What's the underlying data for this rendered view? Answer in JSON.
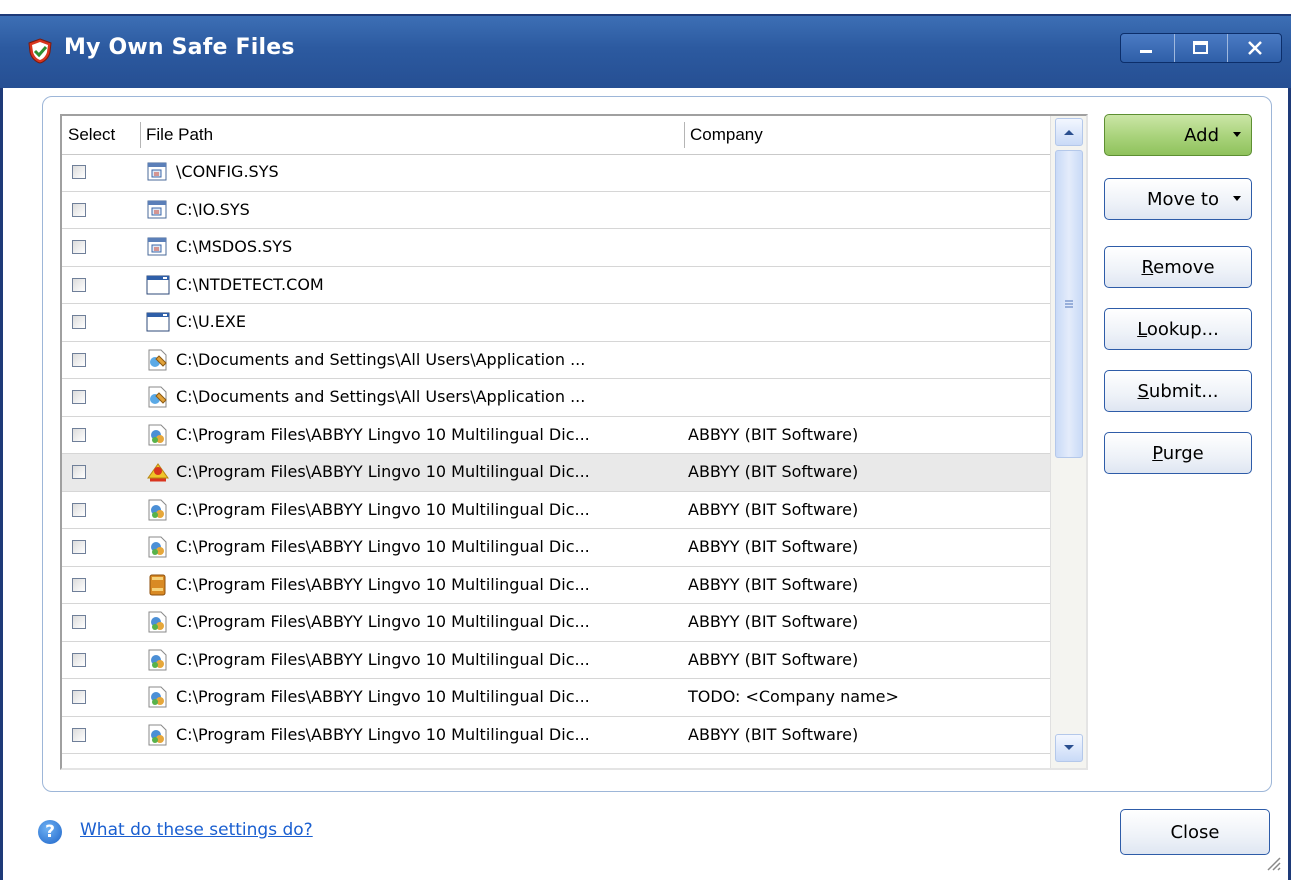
{
  "window": {
    "title": "My Own Safe Files",
    "controls": [
      "minimize-icon",
      "maximize-icon",
      "close-icon"
    ]
  },
  "colors": {
    "titlebar": "#2c5aa0",
    "add_button": "#a8d27a",
    "link": "#1a5fd0",
    "selected_row": "#e9e9e9"
  },
  "list": {
    "columns": {
      "select": "Select",
      "file_path": "File Path",
      "company": "Company"
    },
    "rows": [
      {
        "icon": "system-file-icon",
        "path": "\\CONFIG.SYS",
        "company": "",
        "checked": false
      },
      {
        "icon": "system-file-icon",
        "path": "C:\\IO.SYS",
        "company": "",
        "checked": false
      },
      {
        "icon": "system-file-icon",
        "path": "C:\\MSDOS.SYS",
        "company": "",
        "checked": false
      },
      {
        "icon": "app-window-icon",
        "path": "C:\\NTDETECT.COM",
        "company": "",
        "checked": false
      },
      {
        "icon": "app-window-icon",
        "path": "C:\\U.EXE",
        "company": "",
        "checked": false
      },
      {
        "icon": "settings-file-icon",
        "path": "C:\\Documents and Settings\\All Users\\Application ...",
        "company": "",
        "checked": false
      },
      {
        "icon": "settings-file-icon",
        "path": "C:\\Documents and Settings\\All Users\\Application ...",
        "company": "",
        "checked": false
      },
      {
        "icon": "dll-file-icon",
        "path": "C:\\Program Files\\ABBYY Lingvo 10 Multilingual Dic...",
        "company": "ABBYY (BIT Software)",
        "checked": false
      },
      {
        "icon": "lingvo-app-icon",
        "path": "C:\\Program Files\\ABBYY Lingvo 10 Multilingual Dic...",
        "company": "ABBYY (BIT Software)",
        "checked": false,
        "selected": true
      },
      {
        "icon": "dll-file-icon",
        "path": "C:\\Program Files\\ABBYY Lingvo 10 Multilingual Dic...",
        "company": "ABBYY (BIT Software)",
        "checked": false
      },
      {
        "icon": "dll-file-icon",
        "path": "C:\\Program Files\\ABBYY Lingvo 10 Multilingual Dic...",
        "company": "ABBYY (BIT Software)",
        "checked": false
      },
      {
        "icon": "book-icon",
        "path": "C:\\Program Files\\ABBYY Lingvo 10 Multilingual Dic...",
        "company": "ABBYY (BIT Software)",
        "checked": false
      },
      {
        "icon": "dll-file-icon",
        "path": "C:\\Program Files\\ABBYY Lingvo 10 Multilingual Dic...",
        "company": "ABBYY (BIT Software)",
        "checked": false
      },
      {
        "icon": "dll-file-icon",
        "path": "C:\\Program Files\\ABBYY Lingvo 10 Multilingual Dic...",
        "company": "ABBYY (BIT Software)",
        "checked": false
      },
      {
        "icon": "dll-file-icon",
        "path": "C:\\Program Files\\ABBYY Lingvo 10 Multilingual Dic...",
        "company": "TODO: <Company name>",
        "checked": false
      },
      {
        "icon": "dll-file-icon",
        "path": "C:\\Program Files\\ABBYY Lingvo 10 Multilingual Dic...",
        "company": "ABBYY (BIT Software)",
        "checked": false
      }
    ]
  },
  "buttons": {
    "add": "Add",
    "move_to": "Move to",
    "remove": {
      "pre": "",
      "key": "R",
      "post": "emove"
    },
    "lookup": {
      "pre": "",
      "key": "L",
      "post": "ookup..."
    },
    "submit": {
      "pre": "",
      "key": "S",
      "post": "ubmit..."
    },
    "purge": {
      "pre": "",
      "key": "P",
      "post": "urge"
    },
    "close": "Close"
  },
  "footer": {
    "help_icon": "question-icon",
    "help_link": "What do these settings do?"
  }
}
